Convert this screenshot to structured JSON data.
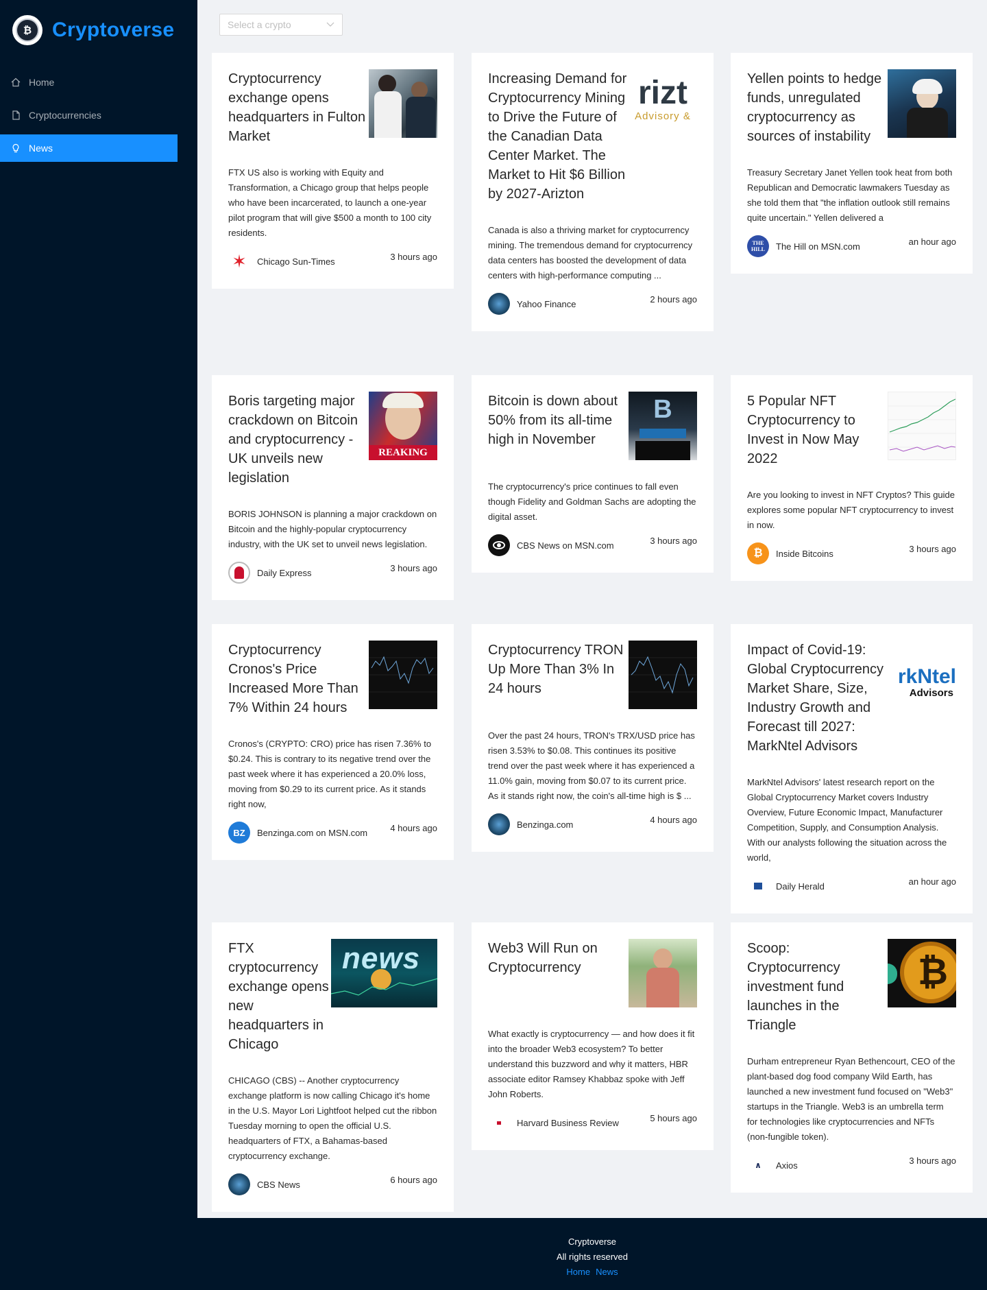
{
  "app": {
    "title": "Cryptoverse",
    "logo_text": "₿"
  },
  "menu": [
    {
      "label": "Home",
      "icon": "home-icon"
    },
    {
      "label": "Cryptocurrencies",
      "icon": "file-icon"
    },
    {
      "label": "News",
      "icon": "bulb-icon"
    }
  ],
  "select": {
    "placeholder": "Select a crypto"
  },
  "articles": [
    {
      "title": "Cryptocurrency exchange opens headquarters in Fulton Market",
      "desc": "FTX US also is working with Equity and Transformation, a Chicago group that helps people who have been incarcerated, to launch a one-year pilot program that will give $500 a month to 100 city residents.",
      "provider": "Chicago Sun-Times",
      "time": "3 hours ago"
    },
    {
      "title": "Increasing Demand for Cryptocurrency Mining to Drive the Future of the Canadian Data Center Market. The Market to Hit $6 Billion by 2027-Arizton",
      "desc": "Canada is also a thriving market for cryptocurrency mining. The tremendous demand for cryptocurrency data centers has boosted the development of data centers with high-performance computing ...",
      "provider": "Yahoo Finance",
      "time": "2 hours ago",
      "thumb_text": "rizt",
      "thumb_sub": "Advisory &"
    },
    {
      "title": "Yellen points to hedge funds, unregulated cryptocurrency as sources of instability",
      "desc": "Treasury Secretary Janet Yellen took heat from both Republican and Democratic lawmakers Tuesday as she told them that \"the inflation outlook still remains quite uncertain.\" Yellen delivered a",
      "provider": "The Hill on MSN.com",
      "time": "an hour ago",
      "icon_text": "THE HILL"
    },
    {
      "title": "Boris targeting major crackdown on Bitcoin and cryptocurrency - UK unveils new legislation",
      "desc": "BORIS JOHNSON is planning a major crackdown on Bitcoin and the highly-popular cryptocurrency industry, with the UK set to unveil news legislation.",
      "provider": "Daily Express",
      "time": "3 hours ago",
      "thumb_text": "REAKING"
    },
    {
      "title": "Bitcoin is down about 50% from its all-time high in November",
      "desc": "The cryptocurrency's price continues to fall even though Fidelity and Goldman Sachs are adopting the digital asset.",
      "provider": "CBS News on MSN.com",
      "time": "3 hours ago",
      "thumb_text": "B"
    },
    {
      "title": "5 Popular NFT Cryptocurrency to Invest in Now May 2022",
      "desc": "Are you looking to invest in NFT Cryptos? This guide explores some popular NFT cryptocurrency to invest in now.",
      "provider": "Inside Bitcoins",
      "time": "3 hours ago",
      "icon_text": "₿"
    },
    {
      "title": "Cryptocurrency Cronos's Price Increased More Than 7% Within 24 hours",
      "desc": "Cronos's (CRYPTO: CRO) price has risen 7.36% to $0.24. This is contrary to its negative trend over the past week where it has experienced a 20.0% loss, moving from $0.29 to its current price. As it stands right now,",
      "provider": "Benzinga.com on MSN.com",
      "time": "4 hours ago",
      "icon_text": "BZ"
    },
    {
      "title": "Cryptocurrency TRON Up More Than 3% In 24 hours",
      "desc": "Over the past 24 hours, TRON's TRX/USD price has risen 3.53% to $0.08. This continues its positive trend over the past week where it has experienced a 11.0% gain, moving from $0.07 to its current price. As it stands right now, the coin's all-time high is $ ...",
      "provider": "Benzinga.com",
      "time": "4 hours ago"
    },
    {
      "title": "Impact of Covid-19: Global Cryptocurrency Market Share, Size, Industry Growth and Forecast till 2027: MarkNtel Advisors",
      "desc": "MarkNtel Advisors' latest research report on the Global Cryptocurrency Market covers Industry Overview, Future Economic Impact, Manufacturer Competition, Supply, and Consumption Analysis. With our analysts following the situation across the world,",
      "provider": "Daily Herald",
      "time": "an hour ago",
      "thumb_text": "rkNtel",
      "thumb_sub": "Advisors"
    },
    {
      "title": "FTX cryptocurrency exchange opens new headquarters in Chicago",
      "desc": "CHICAGO (CBS) -- Another cryptocurrency exchange platform is now calling Chicago it's home in the U.S. Mayor Lori Lightfoot helped cut the ribbon Tuesday morning to open the official U.S. headquarters of FTX, a Bahamas-based cryptocurrency exchange.",
      "provider": "CBS News",
      "time": "6 hours ago",
      "thumb_text": "news"
    },
    {
      "title": "Web3 Will Run on Cryptocurrency",
      "desc": "What exactly is cryptocurrency — and how does it fit into the broader Web3 ecosystem? To better understand this buzzword and why it matters, HBR associate editor Ramsey Khabbaz spoke with Jeff John Roberts.",
      "provider": "Harvard Business Review",
      "time": "5 hours ago"
    },
    {
      "title": "Scoop: Cryptocurrency investment fund launches in the Triangle",
      "desc": "Durham entrepreneur Ryan Bethencourt, CEO of the plant-based dog food company Wild Earth, has launched a new investment fund focused on \"Web3\" startups in the Triangle. Web3 is an umbrella term for technologies like cryptocurrencies and NFTs (non-fungible token).",
      "provider": "Axios",
      "time": "3 hours ago",
      "thumb_text": "₿"
    }
  ],
  "footer": {
    "title": "Cryptoverse",
    "rights": "All rights reserved",
    "links": [
      "Home",
      "News"
    ]
  },
  "colors": {
    "sider": "#001529",
    "accent": "#1890ff",
    "bg": "#f0f2f5"
  }
}
